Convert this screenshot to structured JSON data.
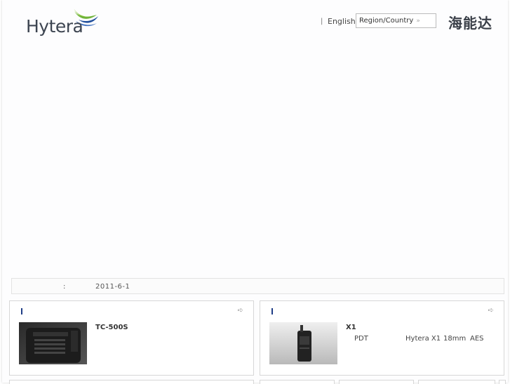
{
  "header": {
    "logo_text": "Hytera",
    "lang_separator": "|",
    "lang_link": "English",
    "region_select": {
      "value": "Region/Country",
      "chevron": "»"
    },
    "brand_cn": "海能达"
  },
  "news": {
    "colon": ":",
    "date": "2011-6-1"
  },
  "panels": [
    {
      "arrow_icon": "double-arrow-right-icon",
      "arrow_glyph": "➪",
      "product_name": "TC-500S",
      "desc": []
    },
    {
      "arrow_icon": "double-arrow-right-icon",
      "arrow_glyph": "➪",
      "product_name": "X1",
      "desc": [
        "PDT",
        "Hytera X1",
        "18mm",
        "AES"
      ]
    }
  ],
  "colors": {
    "accent_marker": "#1f3d86",
    "logo_green": "#8dc63f",
    "logo_blue": "#1f4e9c"
  }
}
